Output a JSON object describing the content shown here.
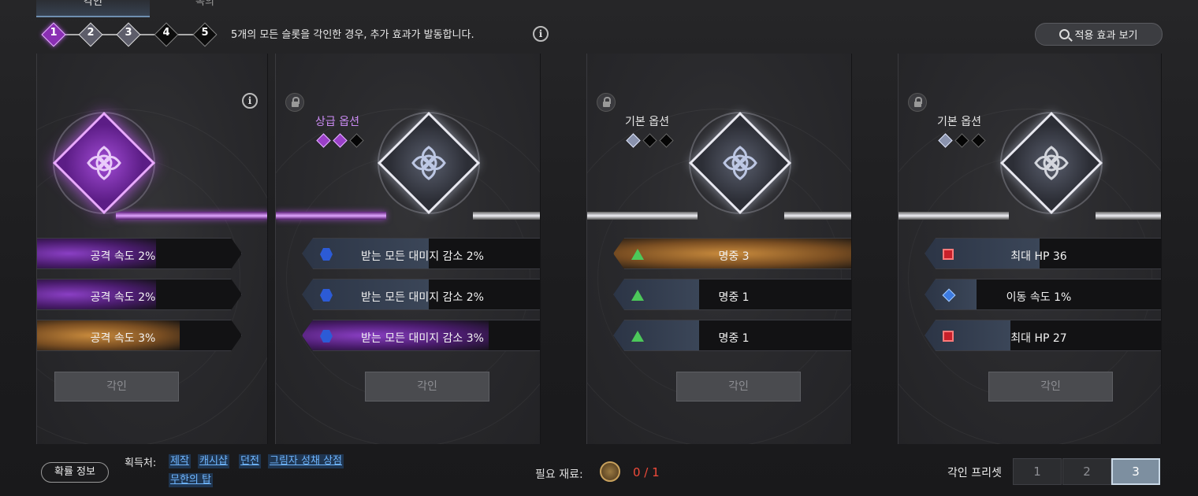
{
  "tabs": [
    {
      "label": "각인"
    },
    {
      "label": "속의"
    }
  ],
  "steps": [
    "1",
    "2",
    "3",
    "4",
    "5"
  ],
  "notice": "5개의 모든 슬롯을 각인한 경우, 추가 효과가 발동합니다.",
  "view_effects_label": "적용 효과 보기",
  "panels": [
    {
      "grade": "",
      "options": [
        {
          "text": "공격 속도 2%"
        },
        {
          "text": "공격 속도 2%"
        },
        {
          "text": "공격 속도 3%"
        }
      ],
      "engrave_label": "각인"
    },
    {
      "grade": "상급 옵션",
      "options": [
        {
          "text": "받는 모든 대미지 감소 2%"
        },
        {
          "text": "받는 모든 대미지 감소 2%"
        },
        {
          "text": "받는 모든 대미지 감소 3%"
        }
      ],
      "engrave_label": "각인"
    },
    {
      "grade": "기본 옵션",
      "options": [
        {
          "text": "명중 3"
        },
        {
          "text": "명중 1"
        },
        {
          "text": "명중 1"
        }
      ],
      "engrave_label": "각인"
    },
    {
      "grade": "기본 옵션",
      "options": [
        {
          "text": "최대 HP 36"
        },
        {
          "text": "이동 속도 1%"
        },
        {
          "text": "최대 HP 27"
        }
      ],
      "engrave_label": "각인"
    }
  ],
  "bottom": {
    "probability_label": "확률 정보",
    "source_label": "획득처:",
    "sources": [
      "제작",
      "캐시샵",
      "던전",
      "그림자 성채 상점",
      "무한의 탑"
    ],
    "materials_label": "필요 재료:",
    "materials_count": "0 / 1",
    "preset_label": "각인 프리셋",
    "presets": [
      "1",
      "2",
      "3"
    ],
    "active_preset": "3"
  },
  "colors": {
    "accent_purple": "#9a3fc8",
    "accent_gold": "#c98b3d",
    "link_blue": "#6fb6ff",
    "warning_red": "#f04a3a"
  }
}
